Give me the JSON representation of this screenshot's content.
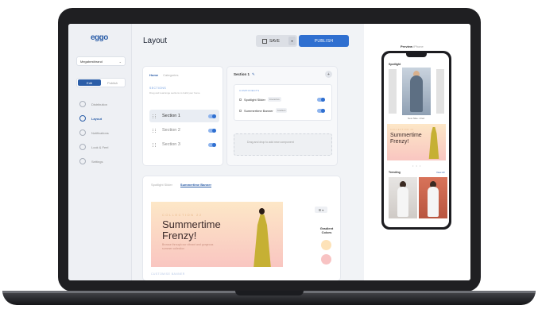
{
  "app": {
    "logo": "eggo"
  },
  "sidebar": {
    "store": "Megabestbrand",
    "mode": {
      "edit": "Edit",
      "publish": "Publish"
    },
    "items": [
      {
        "label": "Distribution",
        "active": false
      },
      {
        "label": "Layout",
        "active": true
      },
      {
        "label": "Notifications",
        "active": false
      },
      {
        "label": "Look & Feel",
        "active": false
      },
      {
        "label": "Settings",
        "active": false
      }
    ]
  },
  "header": {
    "title": "Layout",
    "save_label": "SAVE",
    "publish_label": "PUBLISH"
  },
  "sections_panel": {
    "tabs": [
      "Home",
      "Categories"
    ],
    "heading": "SECTIONS",
    "description": "Drag and rearrange sections to build your home",
    "items": [
      "Section 1",
      "Section 2",
      "Section 3"
    ]
  },
  "section_detail": {
    "title": "Section 1",
    "components_heading": "COMPONENTS",
    "components": [
      {
        "name": "Spotlight Slider",
        "badge": "Interactive"
      },
      {
        "name": "Summertime Banner",
        "badge": "Gradient"
      }
    ],
    "drop_hint": "Drag and drop to add new component"
  },
  "banner_editor": {
    "tabs": [
      "Spotlight Slider",
      "Summertime Banner"
    ],
    "kicker": "COLLECTION 22",
    "title_line1": "Summertime",
    "title_line2": "Frenzy!",
    "subtitle": "Browse through our vibrant and gorgeous summer collection",
    "gradient_label": "Gradient Colors",
    "side_control": "⊞ ▾",
    "footer": "CUSTOMISE BANNER",
    "colors": {
      "swatch1": "#fde2b8",
      "swatch2": "#f8c3c3"
    }
  },
  "preview": {
    "label": "Preview",
    "sub": "iPhone",
    "spotlight": "Spotlight",
    "caption": "New Nike • Red",
    "banner_title_1": "Summertime",
    "banner_title_2": "Frenzy!",
    "dots": "• • •",
    "trending": "Trending",
    "view_all": "View All"
  }
}
